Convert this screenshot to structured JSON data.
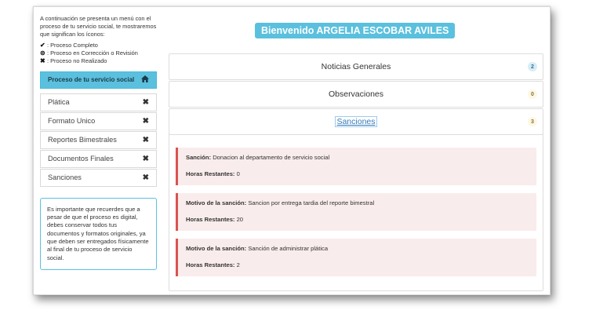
{
  "sidebar": {
    "intro": "A continuación se presenta un menú con el proceso de tu servicio social, te mostraremos que significan los íconos:",
    "legend": [
      {
        "glyph": "✔",
        "icon": "check-icon",
        "text": ": Proceso Completo"
      },
      {
        "glyph": "⊜",
        "icon": "in-review-icon",
        "text": ": Proceso en Corrección o Revisión"
      },
      {
        "glyph": "✖",
        "icon": "cross-icon",
        "text": ": Proceso no Realizado"
      }
    ],
    "menu_title": "Proceso de tu servicio social",
    "menu_items": [
      {
        "label": "Plática",
        "status_glyph": "✖"
      },
      {
        "label": "Formato Unico",
        "status_glyph": "✖"
      },
      {
        "label": "Reportes Bimestrales",
        "status_glyph": "✖"
      },
      {
        "label": "Documentos Finales",
        "status_glyph": "✖"
      },
      {
        "label": "Sanciones",
        "status_glyph": "✖"
      }
    ],
    "note": "Es importante que recuerdes que a pesar de que el proceso es digital, debes conservar todos tus documentos y formatos originales, ya que deben ser entregados físicamente al final de tu proceso de servicio social."
  },
  "header": {
    "welcome": "Bienvenido ARGELIA ESCOBAR AVILES"
  },
  "panels": [
    {
      "title": "Noticias Generales",
      "badge": "2",
      "badge_color": "#d9edf7"
    },
    {
      "title": "Observaciones",
      "badge": "0",
      "badge_color": "#fcf8e3"
    },
    {
      "title": "Sanciones",
      "badge": "3",
      "badge_color": "#fcf8e3"
    }
  ],
  "sanctions": [
    {
      "label": "Sanción:",
      "text": " Donacion al departamento de servicio social",
      "hours_label": "Horas Restantes:",
      "hours": " 0"
    },
    {
      "label": "Motivo de la sanción:",
      "text": " Sancion por entrega tardia del reporte bimestral",
      "hours_label": "Horas Restantes:",
      "hours": " 20"
    },
    {
      "label": "Motivo de la sanción:",
      "text": " Sanción de administrar plática",
      "hours_label": "Horas Restantes:",
      "hours": " 2"
    }
  ]
}
